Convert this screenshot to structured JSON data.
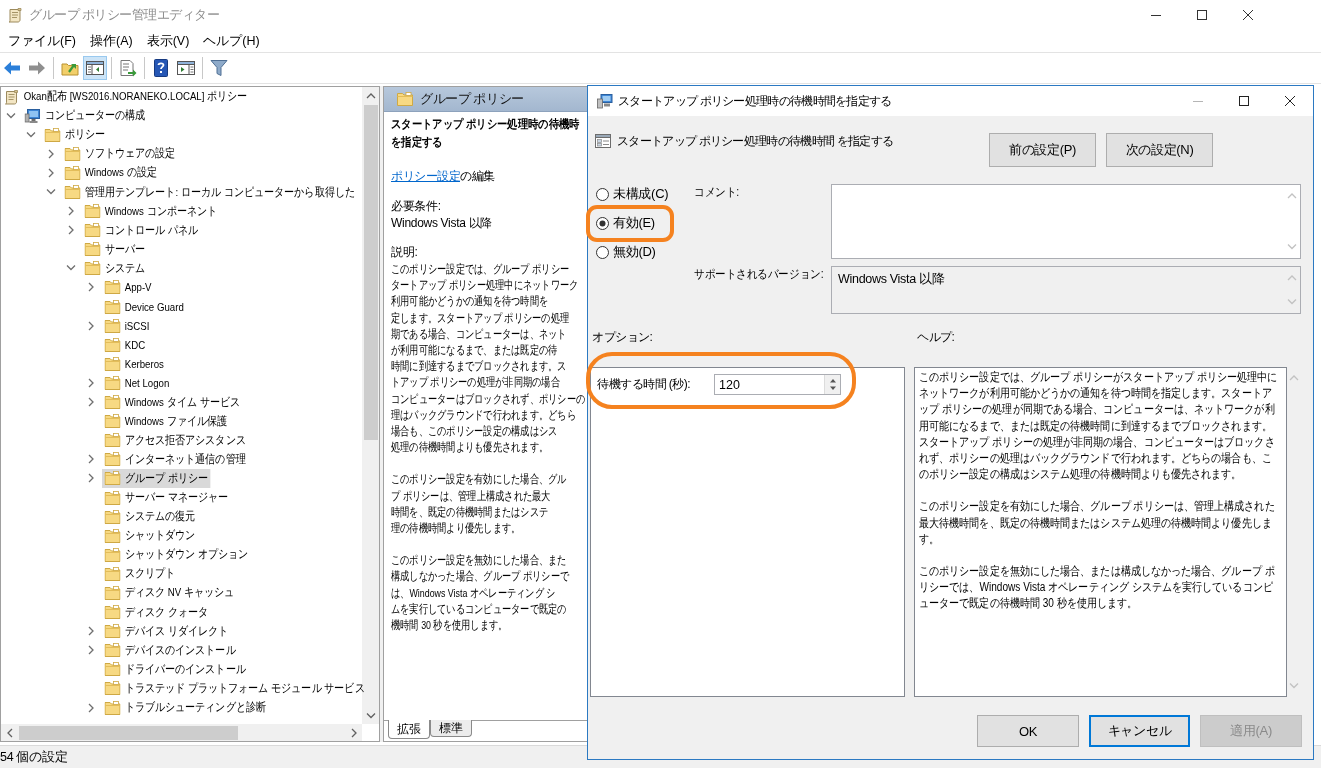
{
  "window": {
    "title": "グループ ポリシー管理エディター"
  },
  "menu": [
    {
      "label": "ファイル(F)"
    },
    {
      "label": "操作(A)"
    },
    {
      "label": "表示(V)"
    },
    {
      "label": "ヘルプ(H)"
    }
  ],
  "toolbar": {
    "groups": [
      {
        "buttons": [
          {
            "kind": "back",
            "disabled": false,
            "pressed": false
          },
          {
            "kind": "forward",
            "disabled": true,
            "pressed": false
          }
        ]
      },
      {
        "buttons": [
          {
            "kind": "up",
            "disabled": false,
            "pressed": false
          },
          {
            "kind": "tree",
            "disabled": false,
            "pressed": true
          }
        ]
      },
      {
        "buttons": [
          {
            "kind": "export",
            "disabled": false,
            "pressed": false
          }
        ]
      },
      {
        "buttons": [
          {
            "kind": "help",
            "disabled": false,
            "pressed": false
          },
          {
            "kind": "action_pane",
            "disabled": false,
            "pressed": false
          }
        ]
      },
      {
        "buttons": [
          {
            "kind": "filter",
            "disabled": false,
            "pressed": false
          }
        ]
      }
    ]
  },
  "tree": {
    "items": [
      {
        "label": "Okan配布 [WS2016.NORANEKO.LOCAL] ポリシー",
        "kind": "policy",
        "selected": false,
        "children": [
          {
            "label": "コンピューターの構成",
            "kind": "computer",
            "expanded": true,
            "selected": false,
            "children": [
              {
                "label": "ポリシー",
                "kind": "folder",
                "expanded": true,
                "selected": false,
                "children": [
                  {
                    "label": "ソフトウェアの設定",
                    "kind": "folder",
                    "expanded": false,
                    "selected": false
                  },
                  {
                    "label": "Windows の設定",
                    "kind": "folder",
                    "expanded": false,
                    "selected": false
                  },
                  {
                    "label": "管理用テンプレート: ローカル コンピューターから取得した",
                    "kind": "folder",
                    "expanded": true,
                    "selected": false,
                    "children": [
                      {
                        "label": "Windows コンポーネント",
                        "kind": "folder",
                        "expanded": false,
                        "selected": false
                      },
                      {
                        "label": "コントロール パネル",
                        "kind": "folder",
                        "expanded": false,
                        "selected": false
                      },
                      {
                        "label": "サーバー",
                        "kind": "folder",
                        "selected": false
                      },
                      {
                        "label": "システム",
                        "kind": "folder",
                        "expanded": true,
                        "selected": false,
                        "children": [
                          {
                            "label": "App-V",
                            "kind": "folder",
                            "expanded": false,
                            "selected": false
                          },
                          {
                            "label": "Device Guard",
                            "kind": "folder",
                            "selected": false
                          },
                          {
                            "label": "iSCSI",
                            "kind": "folder",
                            "expanded": false,
                            "selected": false
                          },
                          {
                            "label": "KDC",
                            "kind": "folder",
                            "selected": false
                          },
                          {
                            "label": "Kerberos",
                            "kind": "folder",
                            "selected": false
                          },
                          {
                            "label": "Net Logon",
                            "kind": "folder",
                            "expanded": false,
                            "selected": false
                          },
                          {
                            "label": "Windows タイム サービス",
                            "kind": "folder",
                            "expanded": false,
                            "selected": false
                          },
                          {
                            "label": "Windows ファイル保護",
                            "kind": "folder",
                            "selected": false
                          },
                          {
                            "label": "アクセス拒否アシスタンス",
                            "kind": "folder",
                            "selected": false
                          },
                          {
                            "label": "インターネット通信の管理",
                            "kind": "folder",
                            "expanded": false,
                            "selected": false
                          },
                          {
                            "label": "グループ ポリシー",
                            "kind": "folder",
                            "expanded": false,
                            "selected": true
                          },
                          {
                            "label": "サーバー マネージャー",
                            "kind": "folder",
                            "selected": false
                          },
                          {
                            "label": "システムの復元",
                            "kind": "folder",
                            "selected": false
                          },
                          {
                            "label": "シャットダウン",
                            "kind": "folder",
                            "selected": false
                          },
                          {
                            "label": "シャットダウン オプション",
                            "kind": "folder",
                            "selected": false
                          },
                          {
                            "label": "スクリプト",
                            "kind": "folder",
                            "selected": false
                          },
                          {
                            "label": "ディスク NV キャッシュ",
                            "kind": "folder",
                            "selected": false
                          },
                          {
                            "label": "ディスク クォータ",
                            "kind": "folder",
                            "selected": false
                          },
                          {
                            "label": "デバイス リダイレクト",
                            "kind": "folder",
                            "expanded": false,
                            "selected": false
                          },
                          {
                            "label": "デバイスのインストール",
                            "kind": "folder",
                            "expanded": false,
                            "selected": false
                          },
                          {
                            "label": "ドライバーのインストール",
                            "kind": "folder",
                            "selected": false
                          },
                          {
                            "label": "トラステッド プラットフォーム モジュール サービス",
                            "kind": "folder",
                            "selected": false
                          },
                          {
                            "label": "トラブルシューティングと診断",
                            "kind": "folder",
                            "expanded": false,
                            "selected": false
                          }
                        ]
                      }
                    ]
                  }
                ]
              }
            ]
          }
        ]
      }
    ]
  },
  "details": {
    "header": "グループ ポリシー",
    "title_lines": [
      "スタートアップ ポリシー処理時の待機時",
      "を指定する"
    ],
    "edit": {
      "link": "ポリシー設定",
      "suffix": "の編集"
    },
    "requirements_label": "必要条件:",
    "requirements": "Windows Vista 以降",
    "description_label": "説明:",
    "description": [
      {
        "lines": [
          "このポリシー設定では、グループ ポリシー",
          "タートアップ ポリシー処理中にネットワーク",
          "利用可能かどうかの通知を待つ時間を",
          "定します。スタートアップ ポリシーの処理",
          "期である場合、コンピューターは、ネット",
          "が利用可能になるまで、または既定の待",
          "時間に到達するまでブロックされます。ス",
          "トアップ ポリシーの処理が非同期の場合",
          "コンピューターはブロックされず、ポリシーの",
          "理はバックグラウンドで行われます。どちら",
          "場合も、このポリシー設定の構成はシス",
          "処理の待機時間よりも優先されます。"
        ]
      },
      {
        "lines": [
          "このポリシー設定を有効にした場合、グル",
          "プ ポリシーは、管理上構成された最大",
          "時間を、既定の待機時間またはシステ",
          "理の待機時間より優先します。"
        ]
      },
      {
        "lines": [
          "このポリシー設定を無効にした場合、また",
          "構成しなかった場合、グループ ポリシーで",
          "は、Windows Vista オペレーティング シ",
          "ムを実行しているコンピューターで既定の",
          "機時間 30 秒を使用します。"
        ]
      }
    ],
    "tabs": [
      {
        "label": "拡張",
        "selected": true
      },
      {
        "label": "標準",
        "selected": false
      }
    ]
  },
  "status_bar": {
    "text": "54 個の設定"
  },
  "dialog": {
    "title": "スタートアップ ポリシー処理時の待機時間を指定する",
    "heading": "スタートアップ ポリシー処理時の待機時間 を指定する",
    "nav_buttons": [
      {
        "label": "前の設定(P)"
      },
      {
        "label": "次の設定(N)"
      }
    ],
    "state_options": [
      {
        "label": "未構成(C)",
        "selected": false,
        "highlighted": false
      },
      {
        "label": "有効(E)",
        "selected": true,
        "highlighted": true
      },
      {
        "label": "無効(D)",
        "selected": false,
        "highlighted": false
      }
    ],
    "comment": {
      "label": "コメント:"
    },
    "supported": {
      "label": "サポートされるバージョン:",
      "value": "Windows Vista 以降"
    },
    "options_label": "オプション:",
    "help_label": "ヘルプ:",
    "options": [
      {
        "label": "待機する時間 (秒):",
        "value": "120",
        "highlighted": true
      }
    ],
    "help_paragraphs": [
      "このポリシー設定では、グループ ポリシーがスタートアップ ポリシー処理中にネットワークが利用可能かどうかの通知を待つ時間を指定します。スタートアップ ポリシーの処理が同期である場合、コンピューターは、ネットワークが利用可能になるまで、または既定の待機時間に到達するまでブロックされます。スタートアップ ポリシーの処理が非同期の場合、コンピューターはブロックされず、ポリシーの処理はバックグラウンドで行われます。どちらの場合も、このポリシー設定の構成はシステム処理の待機時間よりも優先されます。",
      "このポリシー設定を有効にした場合、グループ ポリシーは、管理上構成された最大待機時間を、既定の待機時間またはシステム処理の待機時間より優先します。",
      "このポリシー設定を無効にした場合、または構成しなかった場合、グループ ポリシーでは、Windows Vista オペレーティング システムを実行しているコンピューターで既定の待機時間 30 秒を使用します。"
    ],
    "buttons": [
      {
        "label": "OK",
        "disabled": false,
        "focused": false
      },
      {
        "label": "キャンセル",
        "disabled": false,
        "focused": true
      },
      {
        "label": "適用(A)",
        "disabled": true,
        "focused": false
      }
    ]
  }
}
